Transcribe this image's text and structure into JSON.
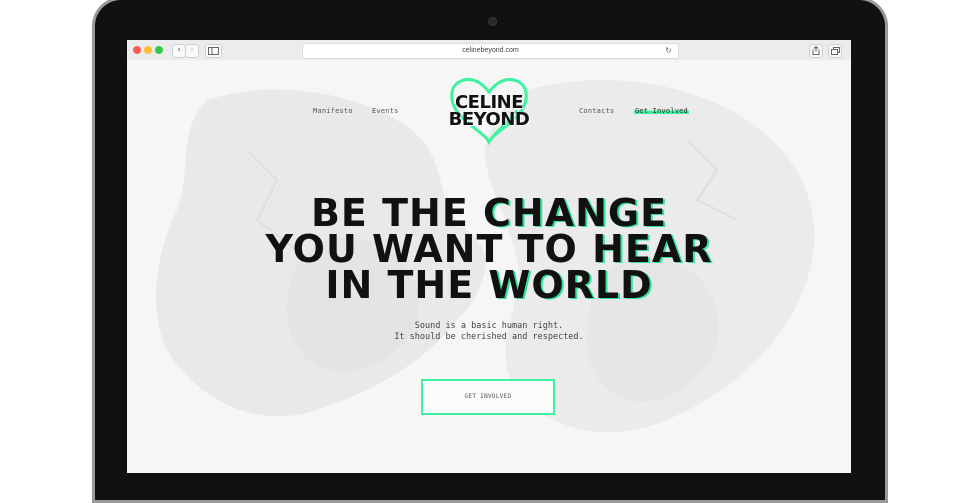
{
  "browser": {
    "url": "celinebeyond.com",
    "icons": [
      "back-icon",
      "forward-icon",
      "sidebar-icon",
      "reload-icon",
      "share-icon",
      "tabs-icon"
    ]
  },
  "nav": {
    "left": [
      "Manifesto",
      "Events"
    ],
    "right": [
      "Contacts",
      "Get Involved"
    ]
  },
  "logo": {
    "line1": "CELINE",
    "line2": "BEYOND"
  },
  "hero": {
    "line1_a": "BE THE ",
    "line1_b": "CHANGE",
    "line2_a": "YOU WANT TO ",
    "line2_b": "HEAR",
    "line3_a": "IN THE ",
    "line3_b": "WORLD",
    "sub1": "Sound is a basic human right.",
    "sub2": "It should be cherished and respected.",
    "cta": "GET INVOLVED"
  },
  "colors": {
    "accent": "#3df3a0",
    "text": "#111111",
    "bezel": "#111111"
  }
}
